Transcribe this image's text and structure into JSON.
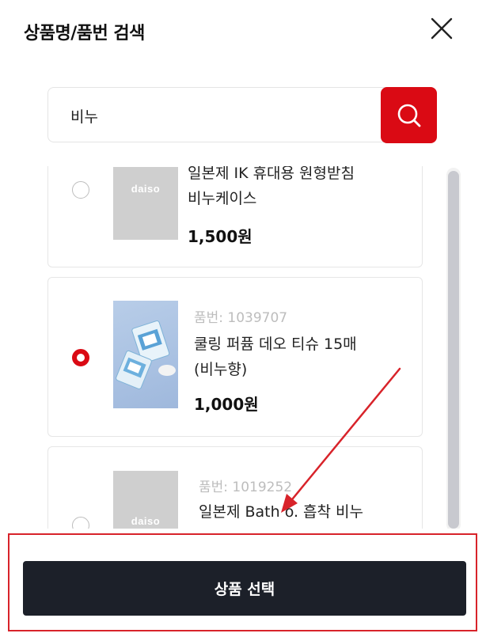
{
  "header": {
    "title": "상품명/품번 검색"
  },
  "search": {
    "value": "비누"
  },
  "products": [
    {
      "brand_logo": "daiso",
      "code": "",
      "name_line1": "일본제 IK 휴대용 원형받침",
      "name_line2": "비누케이스",
      "price": "1,500원",
      "selected": false
    },
    {
      "brand_logo": "",
      "code": "품번: 1039707",
      "name_line1": "쿨링 퍼퓸 데오 티슈 15매",
      "name_line2": "(비누향)",
      "price": "1,000원",
      "selected": true
    },
    {
      "brand_logo": "daiso",
      "code": "품번: 1019252",
      "name_line1": "일본제 Bath o. 흡착 비누",
      "name_line2": "",
      "price": "",
      "selected": false
    }
  ],
  "footer": {
    "select_label": "상품 선택"
  },
  "colors": {
    "accent": "#da0a14",
    "button_dark": "#1c2029",
    "annotation": "#d8232a"
  }
}
